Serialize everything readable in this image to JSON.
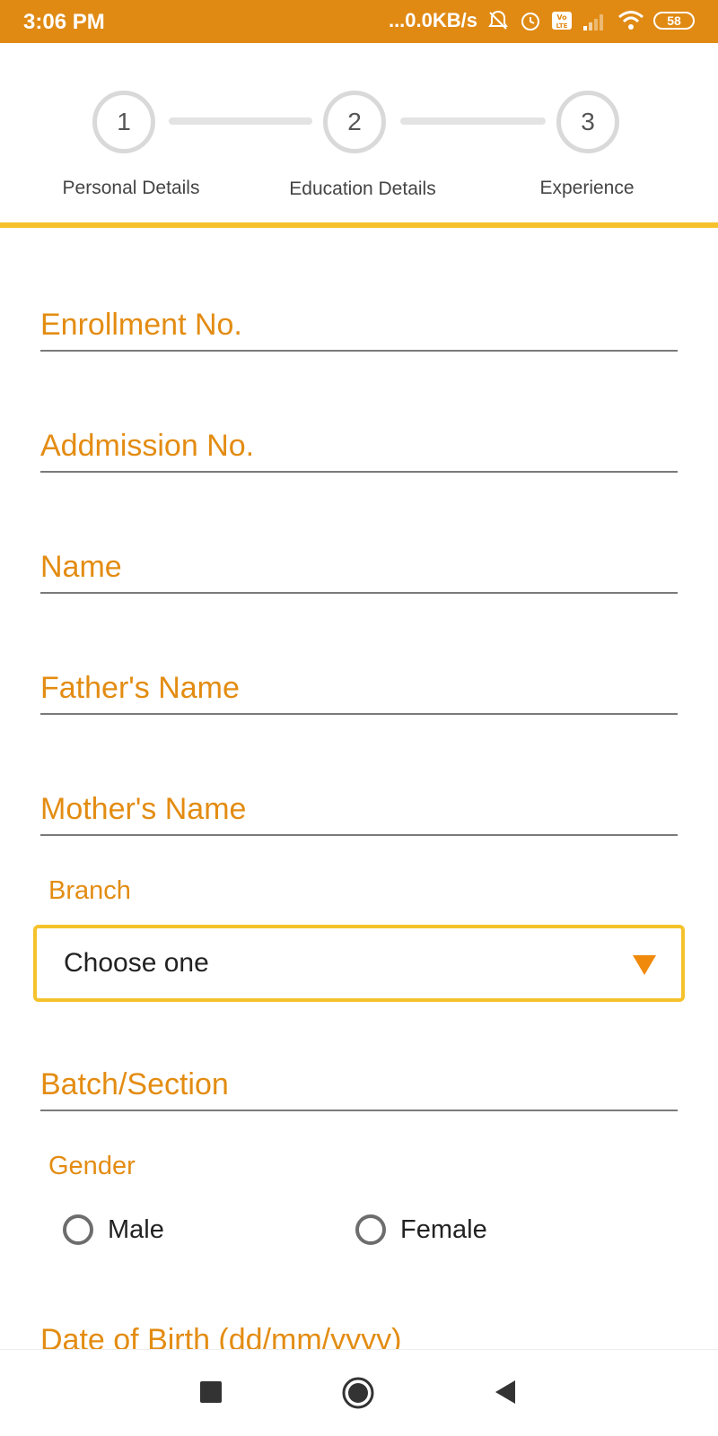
{
  "status_bar": {
    "time": "3:06 PM",
    "network_speed": "...0.0KB/s",
    "battery_level": "58",
    "icons": [
      "mute-bell-icon",
      "alarm-icon",
      "volte-icon",
      "signal-icon",
      "wifi-icon",
      "battery-icon"
    ]
  },
  "stepper": {
    "steps": [
      {
        "number": "1",
        "label": "Personal Details"
      },
      {
        "number": "2",
        "label": "Education Details"
      },
      {
        "number": "3",
        "label": "Experience"
      }
    ]
  },
  "form": {
    "enrollment_no": {
      "placeholder": "Enrollment No.",
      "value": ""
    },
    "admission_no": {
      "placeholder": "Addmission No.",
      "value": ""
    },
    "name": {
      "placeholder": "Name",
      "value": ""
    },
    "fathers_name": {
      "placeholder": "Father's Name",
      "value": ""
    },
    "mothers_name": {
      "placeholder": "Mother's Name",
      "value": ""
    },
    "branch": {
      "label": "Branch",
      "selected": "Choose one"
    },
    "batch_section": {
      "placeholder": "Batch/Section",
      "value": ""
    },
    "gender": {
      "label": "Gender",
      "options": [
        "Male",
        "Female"
      ]
    },
    "date_of_birth": {
      "placeholder": "Date of Birth (dd/mm/yyyy)",
      "value": ""
    }
  },
  "colors": {
    "status_bar": "#e08a14",
    "accent_orange": "#e38c12",
    "accent_yellow": "#f5c22c"
  },
  "nav_bar": {
    "icons": [
      "recent-apps-icon",
      "home-icon",
      "back-icon"
    ]
  }
}
